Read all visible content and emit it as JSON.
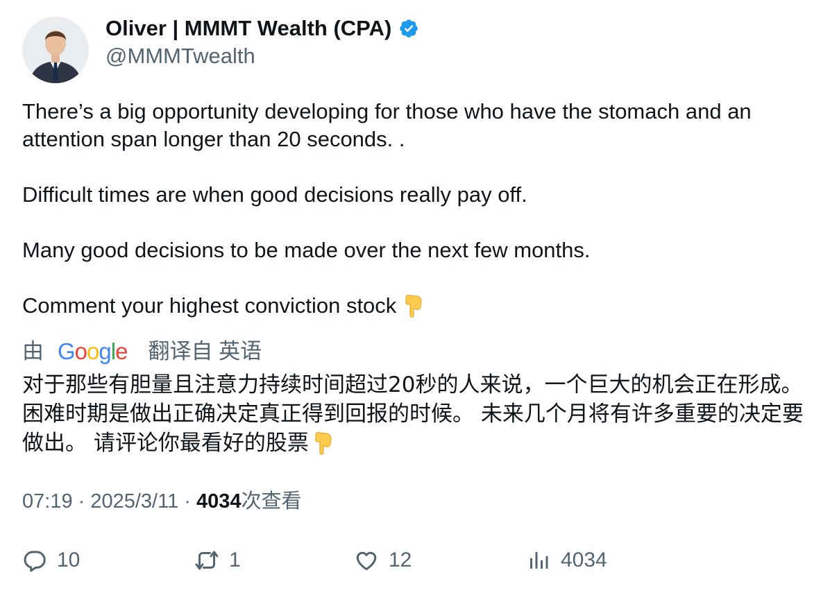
{
  "author": {
    "name": "Oliver | MMMT Wealth (CPA)",
    "handle": "@MMMTwealth",
    "verified_icon": "verified-badge-icon",
    "badge_color": "#1d9bf0"
  },
  "tweet": {
    "para1": "There’s a big opportunity developing for those who have the stomach and an attention span longer than 20 seconds. .",
    "para2": "Difficult times are when good decisions really pay off.",
    "para3": "Many good decisions to be made over the next few months.",
    "para4": "Comment your highest conviction stock",
    "emoji": "backhand-index-pointing-down-emoji"
  },
  "translation": {
    "prefix": "由",
    "provider": "Google",
    "label": "翻译自 英语",
    "text": "对于那些有胆量且注意力持续时间超过20秒的人来说，一个巨大的机会正在形成。 困难时期是做出正确决定真正得到回报的时候。 未来几个月将有许多重要的决定要做出。 请评论你最看好的股票"
  },
  "meta": {
    "time": "07:19",
    "sep1": " · ",
    "date": "2025/3/11",
    "sep2": " · ",
    "views": "4034",
    "views_label": "次查看"
  },
  "actions": {
    "replies": "10",
    "retweets": "1",
    "likes": "12",
    "views": "4034"
  }
}
